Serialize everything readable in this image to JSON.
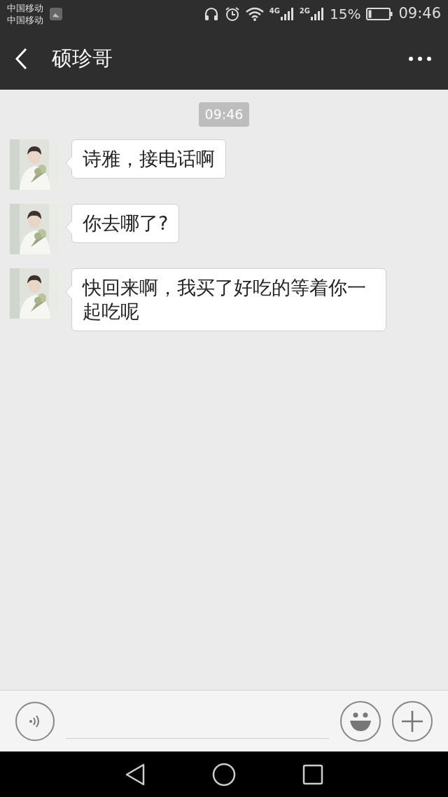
{
  "status_bar": {
    "carriers": [
      "中国移动",
      "中国移动"
    ],
    "network_labels": [
      "4G",
      "2G"
    ],
    "battery": "15%",
    "time": "09:46"
  },
  "header": {
    "title": "硕珍哥"
  },
  "chat": {
    "timestamp": "09:46",
    "messages": [
      {
        "text": "诗雅，接电话啊"
      },
      {
        "text": "你去哪了?"
      },
      {
        "text": "快回来啊，我买了好吃的等着你一起吃呢"
      }
    ]
  }
}
